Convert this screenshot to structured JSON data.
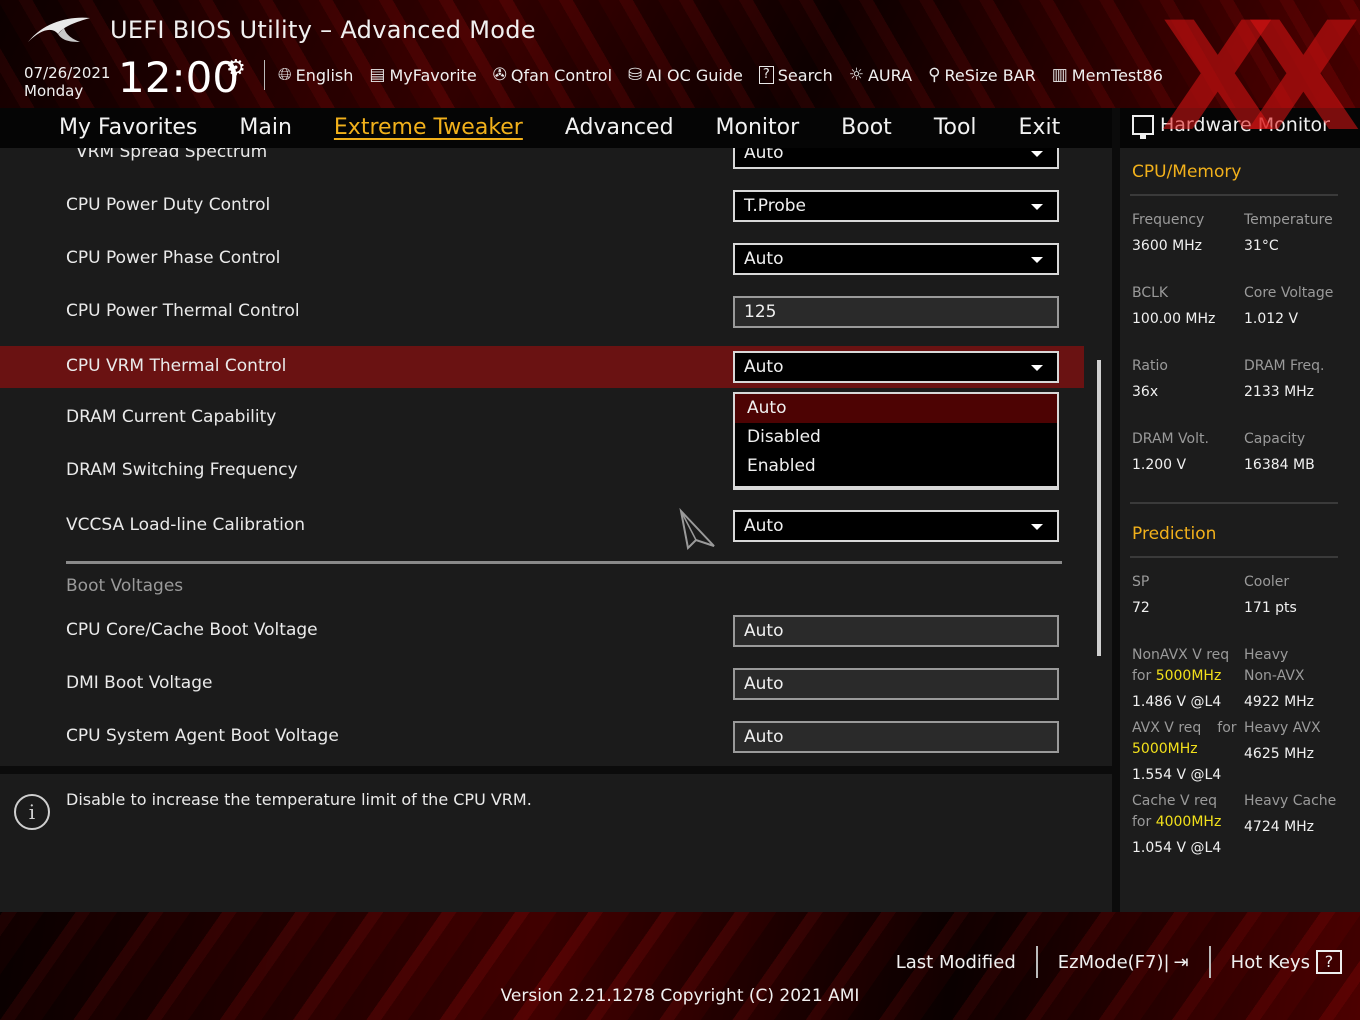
{
  "header": {
    "title": "UEFI BIOS Utility – Advanced Mode",
    "date": "07/26/2021",
    "day": "Monday",
    "time": "12:00",
    "toolbar": [
      {
        "label": "English",
        "icon": "globe-icon"
      },
      {
        "label": "MyFavorite",
        "icon": "favorite-list-icon"
      },
      {
        "label": "Qfan Control",
        "icon": "fan-icon"
      },
      {
        "label": "AI OC Guide",
        "icon": "ai-guide-icon"
      },
      {
        "label": "Search",
        "icon": "search-icon"
      },
      {
        "label": "AURA",
        "icon": "aura-light-icon"
      },
      {
        "label": "ReSize BAR",
        "icon": "resize-bar-icon"
      },
      {
        "label": "MemTest86",
        "icon": "memtest-icon"
      }
    ]
  },
  "tabs": [
    {
      "label": "My Favorites"
    },
    {
      "label": "Main"
    },
    {
      "label": "Extreme Tweaker",
      "active": true
    },
    {
      "label": "Advanced"
    },
    {
      "label": "Monitor"
    },
    {
      "label": "Boot"
    },
    {
      "label": "Tool"
    },
    {
      "label": "Exit"
    }
  ],
  "settings": [
    {
      "label": "VRM Spread Spectrum",
      "value": "Auto"
    },
    {
      "label": "CPU Power Duty Control",
      "value": "T.Probe"
    },
    {
      "label": "CPU Power Phase Control",
      "value": "Auto"
    },
    {
      "label": "CPU Power Thermal Control",
      "value": "125"
    },
    {
      "label": "CPU VRM Thermal Control",
      "value": "Auto"
    },
    {
      "label": "DRAM Current Capability",
      "value": ""
    },
    {
      "label": "DRAM Switching Frequency",
      "value": ""
    },
    {
      "label": "VCCSA Load-line Calibration",
      "value": "Auto"
    }
  ],
  "dropdown_options": [
    "Auto",
    "Disabled",
    "Enabled"
  ],
  "boot_section": {
    "title": "Boot Voltages",
    "items": [
      {
        "label": "CPU Core/Cache Boot Voltage",
        "value": "Auto"
      },
      {
        "label": "DMI Boot Voltage",
        "value": "Auto"
      },
      {
        "label": "CPU System Agent Boot Voltage",
        "value": "Auto"
      }
    ]
  },
  "help_text": "Disable to increase the temperature limit of the CPU VRM.",
  "hw_monitor": {
    "title": "Hardware Monitor",
    "cpu_memory": {
      "title": "CPU/Memory",
      "frequency": {
        "label": "Frequency",
        "value": "3600 MHz"
      },
      "temperature": {
        "label": "Temperature",
        "value": "31°C"
      },
      "bclk": {
        "label": "BCLK",
        "value": "100.00 MHz"
      },
      "core_voltage": {
        "label": "Core Voltage",
        "value": "1.012 V"
      },
      "ratio": {
        "label": "Ratio",
        "value": "36x"
      },
      "dram_freq": {
        "label": "DRAM Freq.",
        "value": "2133 MHz"
      },
      "dram_volt": {
        "label": "DRAM Volt.",
        "value": "1.200 V"
      },
      "capacity": {
        "label": "Capacity",
        "value": "16384 MB"
      }
    },
    "prediction": {
      "title": "Prediction",
      "sp": {
        "label": "SP",
        "value": "72"
      },
      "cooler": {
        "label": "Cooler",
        "value": "171 pts"
      },
      "nonavx_req_1": "NonAVX V req",
      "nonavx_req_for": "for",
      "nonavx_freq": "5000MHz",
      "nonavx_v": "1.486 V @L4",
      "heavy_nonavx_l1": "Heavy",
      "heavy_nonavx_l2": "Non-AVX",
      "heavy_nonavx_v": "4922 MHz",
      "avx_req_1": "AVX V req",
      "avx_req_for": "for",
      "avx_freq": "5000MHz",
      "avx_v": "1.554 V @L4",
      "heavy_avx_l1": "Heavy AVX",
      "heavy_avx_v": "4625 MHz",
      "cache_req_1": "Cache V req",
      "cache_req_for": "for",
      "cache_freq": "4000MHz",
      "cache_v": "1.054 V @L4",
      "heavy_cache_l1": "Heavy Cache",
      "heavy_cache_v": "4724 MHz"
    }
  },
  "footer": {
    "last_modified": "Last Modified",
    "ezmode": "EzMode(F7)|",
    "hotkeys": "Hot Keys",
    "hotkeys_box": "?",
    "version": "Version 2.21.1278 Copyright (C) 2021 AMI"
  },
  "colors": {
    "accent": "#f2b11b",
    "selected_row": "#6a1212",
    "highlight_value": "#f2e01b"
  }
}
